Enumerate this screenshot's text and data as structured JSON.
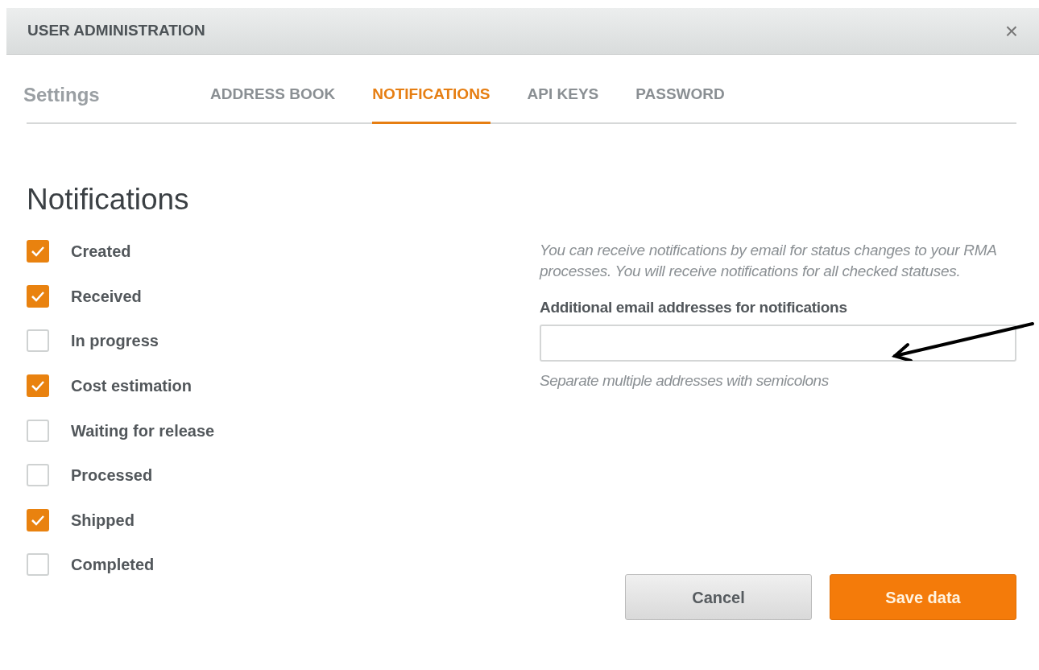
{
  "window": {
    "title": "USER ADMINISTRATION",
    "close": "×"
  },
  "tabs_title": "Settings",
  "tabs": [
    {
      "label": "ADDRESS BOOK",
      "selected": false
    },
    {
      "label": "NOTIFICATIONS",
      "selected": true
    },
    {
      "label": "API KEYS",
      "selected": false
    },
    {
      "label": "PASSWORD",
      "selected": false
    }
  ],
  "heading": "Notifications",
  "statuses": [
    {
      "label": "Created",
      "checked": true
    },
    {
      "label": "Received",
      "checked": true
    },
    {
      "label": "In progress",
      "checked": false
    },
    {
      "label": "Cost estimation",
      "checked": true
    },
    {
      "label": "Waiting for release",
      "checked": false
    },
    {
      "label": "Processed",
      "checked": false
    },
    {
      "label": "Shipped",
      "checked": true
    },
    {
      "label": "Completed",
      "checked": false
    }
  ],
  "description": "You can receive notifications by email for status changes to your RMA processes. You will receive notifications for all checked statuses.",
  "email_field": {
    "label": "Additional email addresses for notifications",
    "hint": "Separate multiple addresses with semicolons"
  },
  "buttons": [
    {
      "label": "Cancel",
      "kind": "secondary"
    },
    {
      "label": "Save data",
      "kind": "primary"
    }
  ]
}
